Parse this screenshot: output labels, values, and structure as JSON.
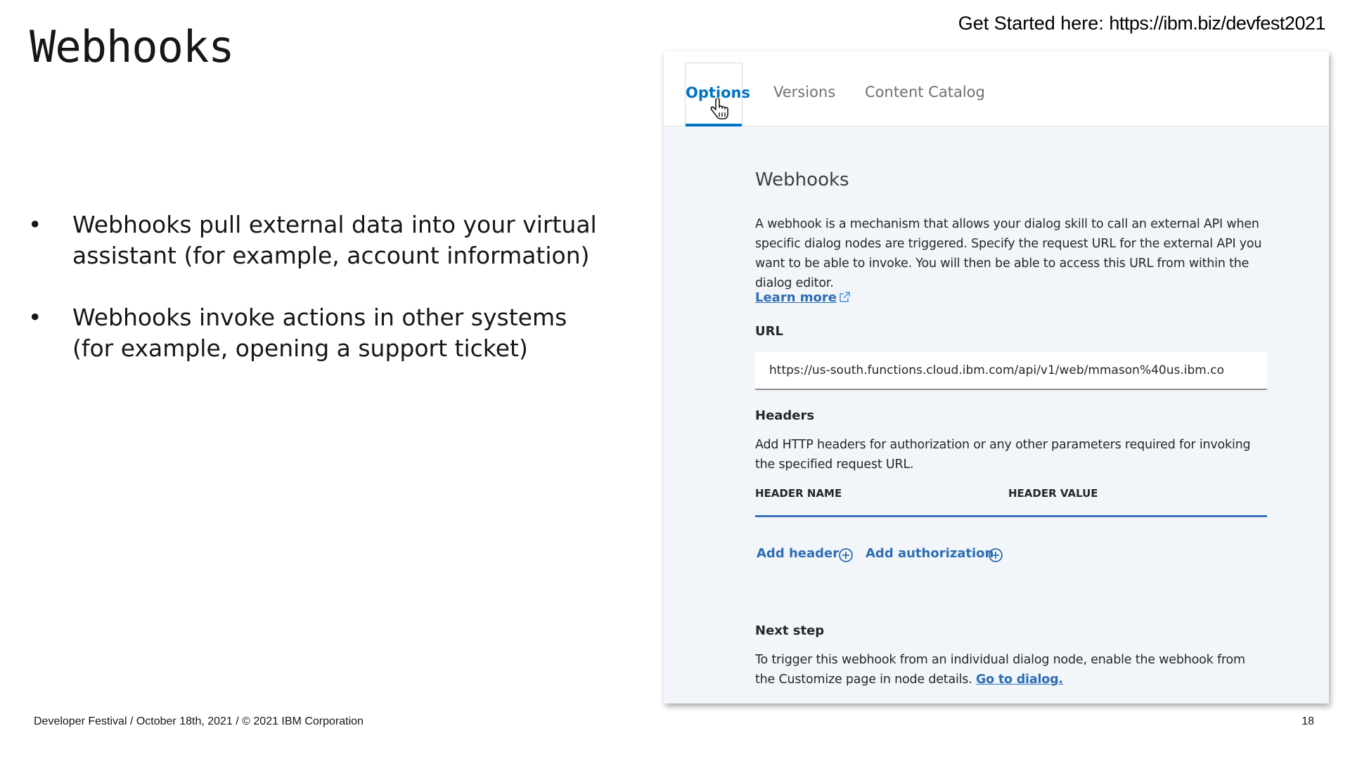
{
  "slide": {
    "title": "Webhooks",
    "get_started_prefix": "Get Started here: ",
    "get_started_url": "https://ibm.biz/devfest2021",
    "bullets": [
      "Webhooks pull external data into your virtual assistant (for example, account information)",
      "Webhooks invoke actions in other systems (for example, opening a support ticket)"
    ],
    "footer": "Developer Festival / October 18th, 2021 / © 2021 IBM Corporation",
    "page_number": "18"
  },
  "panel": {
    "tabs": {
      "options": "Options",
      "versions": "Versions",
      "content_catalog": "Content Catalog"
    },
    "title": "Webhooks",
    "description": "A webhook is a mechanism that allows your dialog skill to call an external API when specific dialog nodes are triggered. Specify the request URL for the external API you want to be able to invoke. You will then be able to access this URL from within the dialog editor.",
    "learn_more": "Learn more",
    "url_label": "URL",
    "url_value": "https://us-south.functions.cloud.ibm.com/api/v1/web/mmason%40us.ibm.co",
    "headers_label": "Headers",
    "headers_description": "Add HTTP headers for authorization or any other parameters required for invoking the specified request URL.",
    "col_header_name": "HEADER NAME",
    "col_header_value": "HEADER VALUE",
    "add_header": "Add header",
    "add_authorization": "Add authorization",
    "next_step_label": "Next step",
    "next_step_text": "To trigger this webhook from an individual dialog node, enable the webhook from the Customize page in node details. ",
    "go_to_dialog": "Go to dialog."
  },
  "colors": {
    "accent_blue": "#0072c3",
    "link_blue": "#2d6db5",
    "panel_bg": "#f2f6fa"
  },
  "icons": [
    "hand-cursor-icon",
    "external-link-icon",
    "plus-circle-icon"
  ]
}
